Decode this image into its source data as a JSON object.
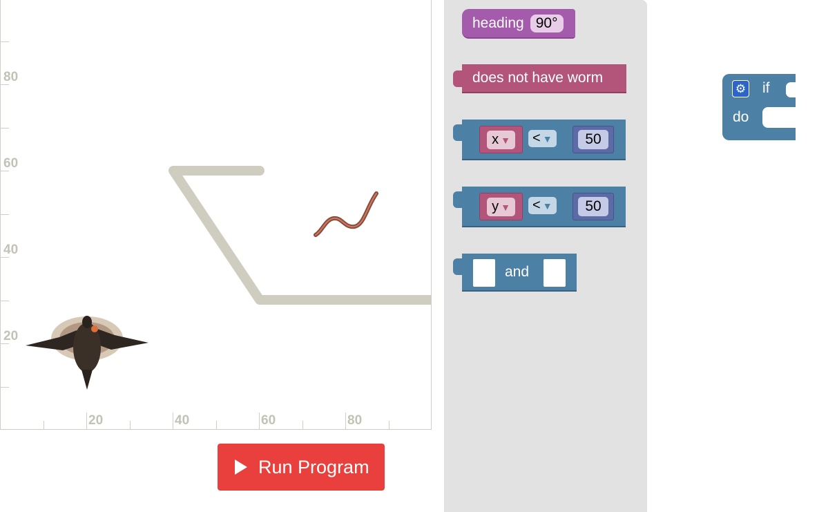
{
  "stage": {
    "y_axis_labels": [
      "80",
      "60",
      "40",
      "20"
    ],
    "x_axis_labels": [
      "20",
      "40",
      "60",
      "80"
    ],
    "bird_icon": "robin-bird-icon",
    "worm_icon": "earthworm-icon"
  },
  "run_button": {
    "label": "Run Program",
    "icon": "play-icon",
    "color": "#e9403d"
  },
  "toolbox": {
    "heading_block": {
      "label": "heading",
      "value": "90°"
    },
    "worm_block": {
      "label": "does not have worm"
    },
    "compare_x": {
      "variable": "x",
      "operator": "<",
      "value": "50"
    },
    "compare_y": {
      "variable": "y",
      "operator": "<",
      "value": "50"
    },
    "and_block": {
      "label": "and"
    }
  },
  "workspace": {
    "if_block": {
      "if_label": "if",
      "do_label": "do",
      "gear_icon": "gear-icon"
    }
  },
  "colors": {
    "heading": "#a55bab",
    "worm_block": "#b3547a",
    "logic": "#4d80a5",
    "number": "#5c6ba6",
    "path": "#cecdc0"
  }
}
